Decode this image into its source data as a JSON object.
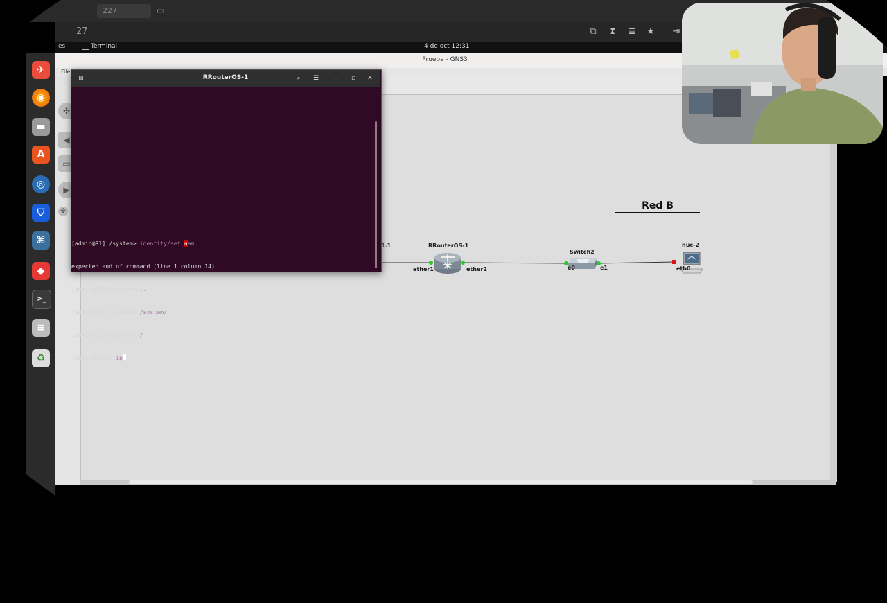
{
  "browser": {
    "tab_chip": "227",
    "path_fragment": "27"
  },
  "ubuntu_bar": {
    "activities": "es",
    "app_name": "Terminal",
    "clock": "4 de oct  12:31"
  },
  "gns3": {
    "window_title": "Prueba - GNS3",
    "menu_first": "File",
    "group_label": "Red B"
  },
  "terminal": {
    "title": "RRouterOS-1",
    "lines": {
      "l1_prompt": "[admin@R1] /system>",
      "l1_cmd": " identity/set ",
      "l1_err": "n",
      "l1_rest": "am",
      "l2": "expected end of command (line 1 column 14)",
      "l3_prompt": "[admin@R1] /system>",
      "l3_cmd": " ..",
      "l4_prompt": "[admin@R1] /system>",
      "l4_cmd": " /system/",
      "l5_prompt": "[admin@R1] /system>",
      "l5_cmd": " /",
      "l6_prompt": "[admin@R1] >",
      "l6_cmd": " ip"
    }
  },
  "topology": {
    "partial_left_label": "1.1",
    "partial_eth_label": "eth0",
    "router": {
      "name": "RRouterOS-1",
      "if_left": "ether1",
      "if_right": "ether2"
    },
    "switch": {
      "name": "Switch2",
      "if_left": "e0",
      "if_right": "e1"
    },
    "host": {
      "name": "nuc-2",
      "if": "eth0"
    }
  },
  "colors": {
    "terminal_bg": "#300a24",
    "link_up": "#22cc22",
    "link_down": "#dd1111",
    "canvas_bg": "#dededf"
  }
}
